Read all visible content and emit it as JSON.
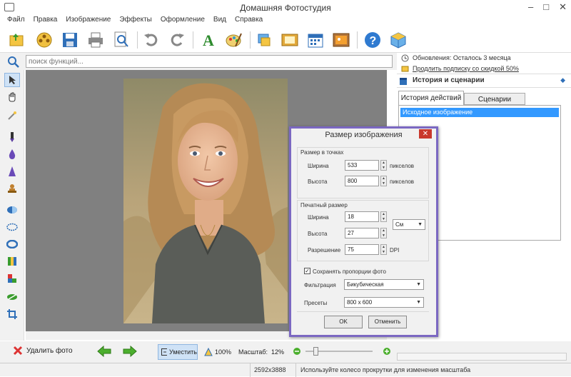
{
  "window": {
    "title": "Домашняя Фотостудия",
    "min": "–",
    "max": "□",
    "close": "✕"
  },
  "menu": [
    "Файл",
    "Правка",
    "Изображение",
    "Эффекты",
    "Оформление",
    "Вид",
    "Справка"
  ],
  "search": {
    "placeholder": "поиск функций..."
  },
  "right": {
    "updates": "Обновления: Осталось  3 месяца",
    "subscription": "Продлить подписку со скидкой 50%",
    "panel_title": "История и сценарии",
    "tabs": [
      "История действий",
      "Сценарии"
    ],
    "history_items": [
      "Исходное изображение"
    ]
  },
  "dialog": {
    "title": "Размер изображения",
    "close": "✕",
    "pixel_group": "Размер в точках",
    "width_label": "Ширина",
    "width_value": "533",
    "height_label": "Высота",
    "height_value": "800",
    "pixel_unit": "пикселов",
    "print_group": "Печатный размер",
    "print_width_label": "Ширина",
    "print_width_value": "18",
    "print_height_label": "Высота",
    "print_height_value": "27",
    "resolution_label": "Разрешение",
    "resolution_value": "75",
    "dpi": "DPI",
    "unit_select": "См",
    "keep_proportions": "Сохранять пропорции фото",
    "filter_label": "Фильтрация",
    "filter_value": "Бикубическая",
    "preset_label": "Пресеты",
    "preset_value": "800 x 600",
    "ok": "OK",
    "cancel": "Отменить"
  },
  "bottom": {
    "delete": "Удалить фото",
    "fit": "Уместить",
    "zoom100": "100%",
    "scale_label": "Масштаб:",
    "scale_value": "12%",
    "zoom_level": 0.12
  },
  "status": {
    "dimensions": "2592x3888",
    "hint": "Используйте колесо прокрутки для изменения масштаба"
  },
  "colors": {
    "dialog_border": "#7b68c2",
    "accent": "#3399ff",
    "close_red": "#c9382c"
  }
}
